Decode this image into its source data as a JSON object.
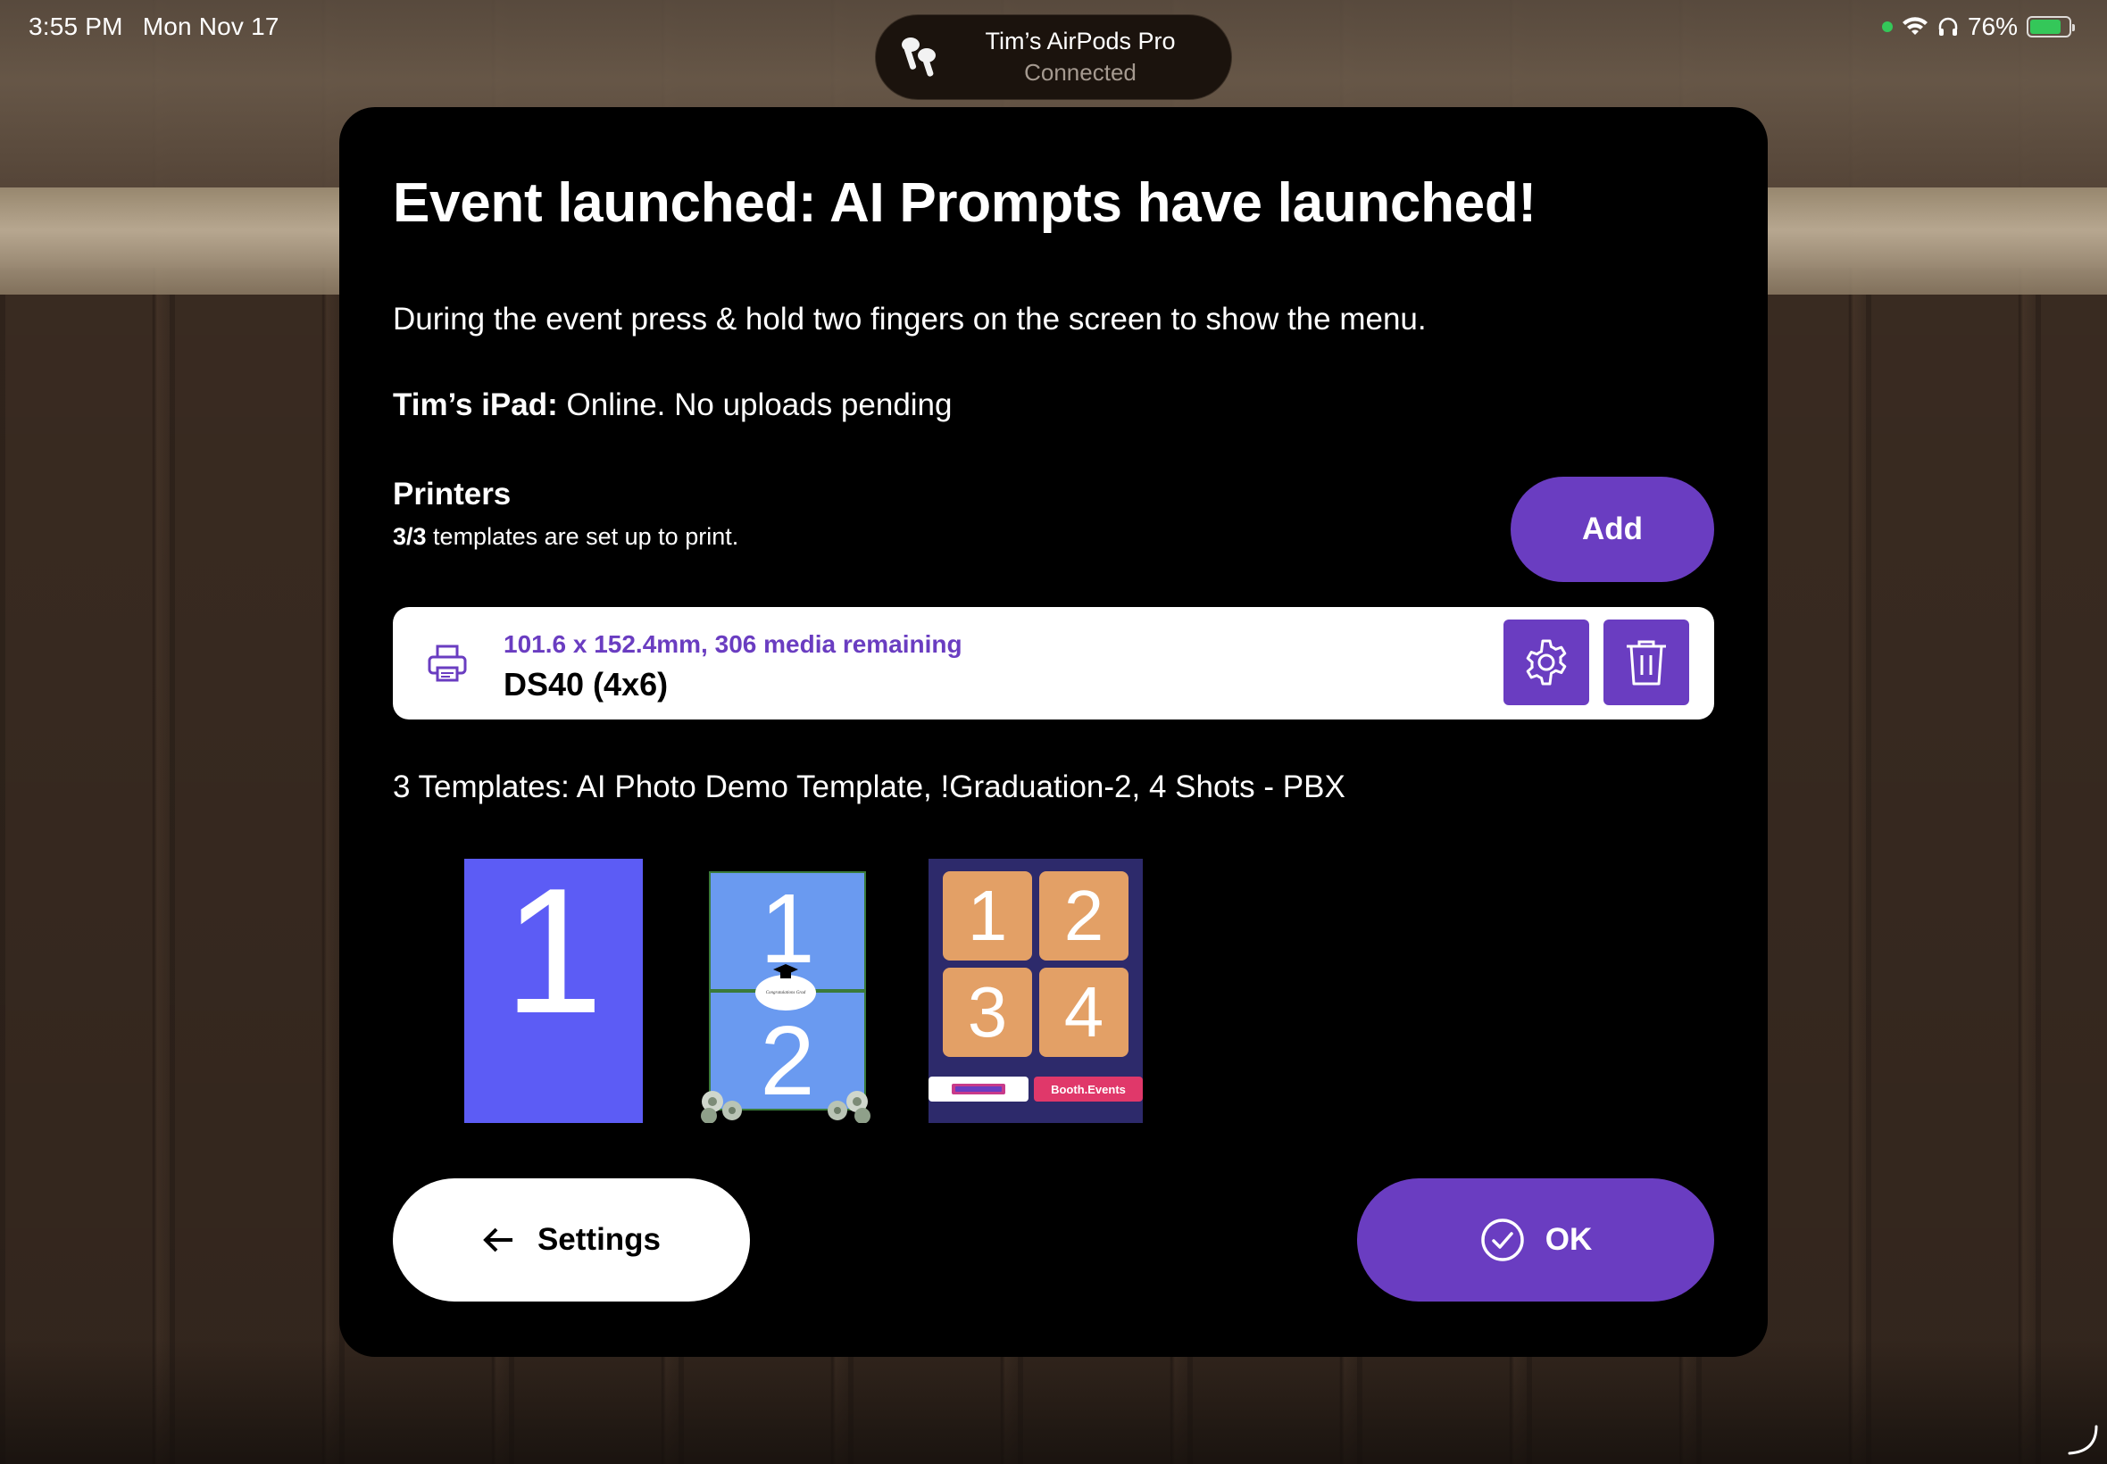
{
  "status_bar": {
    "time": "3:55 PM",
    "date": "Mon Nov 17",
    "battery": "76%",
    "icons": [
      "camera-indicator-dot",
      "wifi-icon",
      "headphones-icon",
      "battery-charging-icon"
    ]
  },
  "airpods": {
    "name": "Tim’s AirPods Pro",
    "status": "Connected"
  },
  "modal": {
    "title": "Event launched: AI Prompts have launched!",
    "description": "During the event press & hold two fingers on the screen to show the menu.",
    "device_name": "Tim’s iPad:",
    "device_status": " Online. No uploads pending",
    "printers": {
      "heading": "Printers",
      "count": "3/3",
      "count_suffix": " templates are set up to print.",
      "add_label": "Add",
      "items": [
        {
          "media": "101.6 x 152.4mm, 306 media remaining",
          "name": "DS40 (4x6)"
        }
      ]
    },
    "templates_text": "3 Templates: AI Photo Demo Template, !Graduation-2, 4 Shots - PBX",
    "templates": [
      {
        "numbers": [
          "1"
        ]
      },
      {
        "numbers": [
          "1",
          "2"
        ],
        "caption": "Congratulations Grad"
      },
      {
        "numbers": [
          "1",
          "2",
          "3",
          "4"
        ],
        "logos": [
          "",
          "Booth.Events"
        ]
      }
    ],
    "settings_label": "Settings",
    "ok_label": "OK"
  },
  "colors": {
    "accent": "#6a3dc1",
    "modal_bg": "#000000",
    "template1_bg": "#5c5cf5",
    "template2_panel": "#6a9af0",
    "template3_bg": "#2d2a6b",
    "template3_cell": "#e3a066"
  }
}
